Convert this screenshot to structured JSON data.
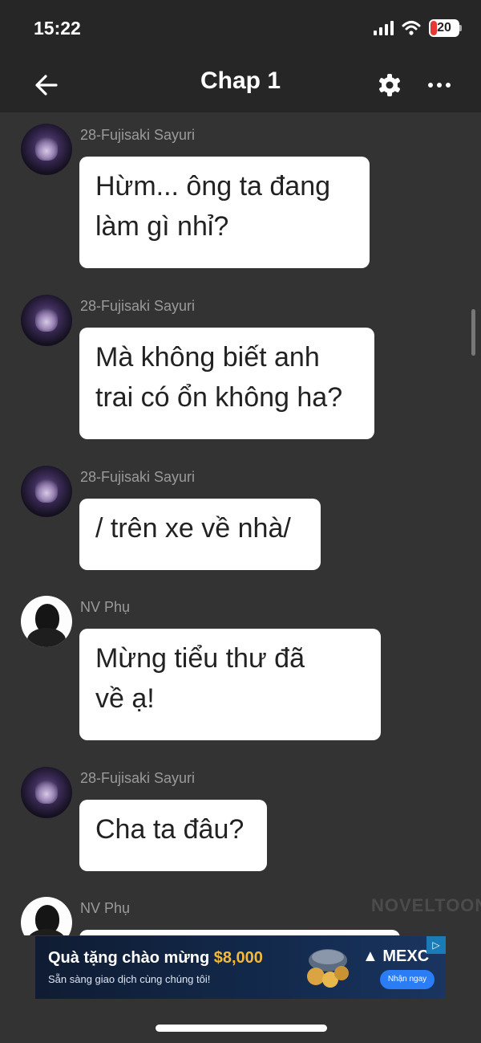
{
  "status_bar": {
    "time": "15:22",
    "battery_level": "20",
    "battery_color": "#e53935",
    "icons": [
      "signal-icon",
      "wifi-icon",
      "battery-icon"
    ]
  },
  "header": {
    "title": "Chap 1",
    "icons": [
      "back-arrow-icon",
      "gear-icon",
      "more-icon"
    ]
  },
  "messages": [
    {
      "sender": "28-Fujisaki Sayuri",
      "avatar": "anime-girl-avatar",
      "text": "Hừm... ông ta đang\nlàm gì nhỉ?"
    },
    {
      "sender": "28-Fujisaki Sayuri",
      "avatar": "anime-girl-avatar",
      "text": "Mà không biết anh\ntrai có ổn không ha?"
    },
    {
      "sender": "28-Fujisaki Sayuri",
      "avatar": "anime-girl-avatar",
      "text": "/ trên xe về nhà/"
    },
    {
      "sender": "NV Phụ",
      "avatar": "silhouette-avatar",
      "text": "Mừng tiểu thư đã\nvề ạ!"
    },
    {
      "sender": "28-Fujisaki Sayuri",
      "avatar": "anime-girl-avatar",
      "text": "Cha ta đâu?"
    },
    {
      "sender": "NV Phụ",
      "avatar": "silhouette-avatar",
      "text": ""
    }
  ],
  "watermark": "NOVELTOON",
  "ad": {
    "title": "Quà tặng chào mừng",
    "amount": "$8,000",
    "subtitle": "Sẵn sàng giao dịch cùng chúng tôi!",
    "brand": "MEXC",
    "cta": "Nhận ngay",
    "amount_color": "#f3b93a",
    "cta_color": "#2a7df4"
  }
}
